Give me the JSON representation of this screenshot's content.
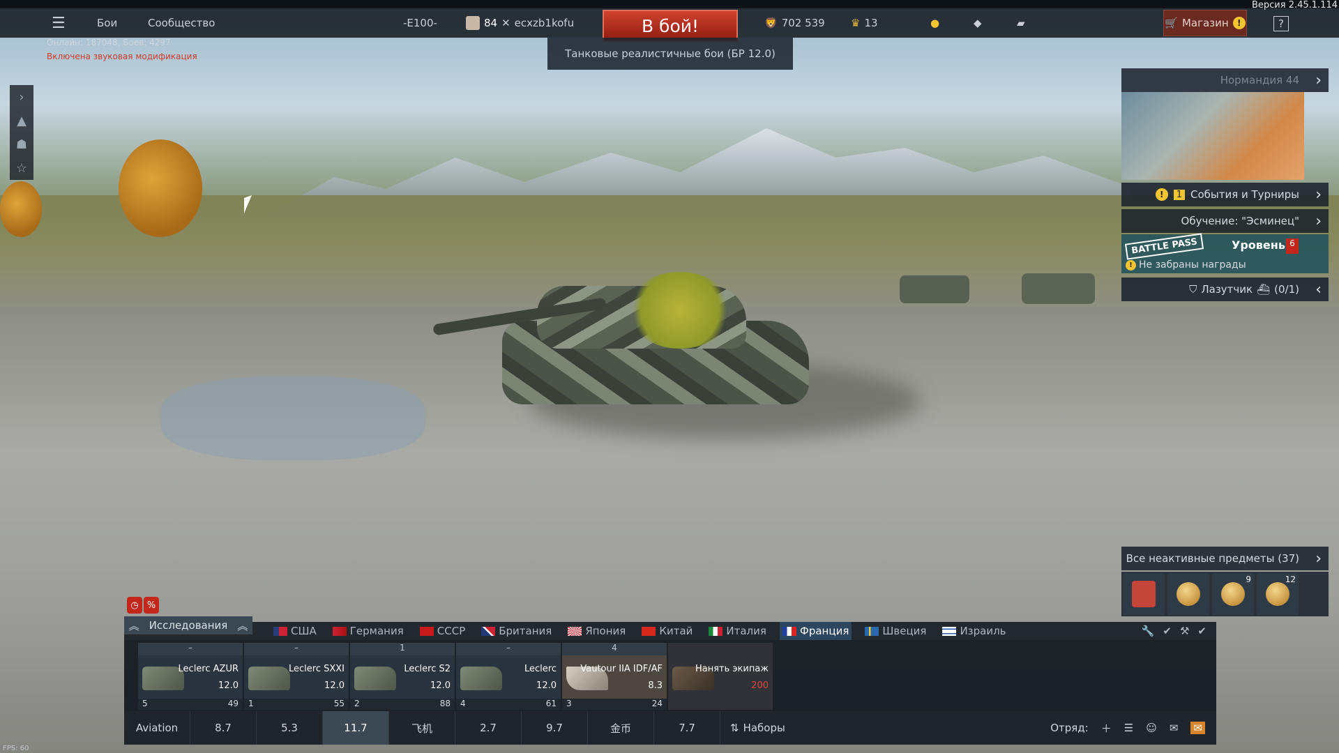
{
  "topbar": {
    "menu_items": [
      "Бои",
      "Сообщество"
    ],
    "vehicle_tag": "-E100-",
    "player_level": "84",
    "player_name": "ecxzb1kofu",
    "battle_button": "В бой!",
    "silver_lions": "702 539",
    "golden_eagles": "13",
    "shop_label": "Магазин",
    "help": "?",
    "version": "Версия 2.45.1.114"
  },
  "status": {
    "online": "Онлайн: 187048, Боев: 4297",
    "sound_mod": "Включена звуковая модификация"
  },
  "mode": {
    "label": "Танковые реалистичные бои (БР 12.0)"
  },
  "right_panel": {
    "normandy": "Нормандия 44",
    "events": "События и Турниры",
    "events_count": "1",
    "tutorial": "Обучение: \"Эсминец\"",
    "battle_pass_logo": "BATTLE PASS",
    "bp_level_label": "Уровень",
    "bp_level": "6",
    "bp_unclaimed": "Не забраны награды",
    "scout": "Лазутчик",
    "scout_count": "(0/1)",
    "inactive_items": "Все неактивные предметы (37)",
    "item_counts": [
      "",
      "",
      "9",
      "12"
    ]
  },
  "bottom": {
    "research_label": "Исследования",
    "nations": [
      {
        "name": "США",
        "flag": "usa-flag"
      },
      {
        "name": "Германия",
        "flag": "germany-flag"
      },
      {
        "name": "СССР",
        "flag": "ussr-flag"
      },
      {
        "name": "Британия",
        "flag": "britain-flag"
      },
      {
        "name": "Япония",
        "flag": "japan-flag"
      },
      {
        "name": "Китай",
        "flag": "china-flag"
      },
      {
        "name": "Италия",
        "flag": "italy-flag"
      },
      {
        "name": "Франция",
        "flag": "france-flag",
        "active": true
      },
      {
        "name": "Швеция",
        "flag": "sweden-flag"
      },
      {
        "name": "Израиль",
        "flag": "israel-flag"
      }
    ],
    "slots": [
      {
        "top": "–",
        "name": "Leclerc AZUR",
        "br": "12.0",
        "crew": "5",
        "cost": "49"
      },
      {
        "top": "–",
        "name": "Leclerc SXXI",
        "br": "12.0",
        "crew": "1",
        "cost": "55"
      },
      {
        "top": "1",
        "name": "Leclerc S2",
        "br": "12.0",
        "crew": "2",
        "cost": "88"
      },
      {
        "top": "–",
        "name": "Leclerc",
        "br": "12.0",
        "crew": "4",
        "cost": "61"
      },
      {
        "top": "4",
        "name": "Vautour IIA IDF/AF",
        "br": "8.3",
        "crew": "3",
        "cost": "24"
      },
      {
        "top": "",
        "name": "Нанять экипаж",
        "br": "200",
        "crew": "",
        "cost": ""
      }
    ],
    "br_bar": [
      "Aviation",
      "8.7",
      "5.3",
      "11.7",
      "飞机",
      "2.7",
      "9.7",
      "金币",
      "7.7"
    ],
    "br_active_index": 3,
    "sets_label": "Наборы",
    "squad_label": "Отряд:",
    "fps": "FPS: 60"
  },
  "colors": {
    "battle_red": "#c5321f",
    "active_nation": "#2c4660",
    "warning": "#f2c531"
  }
}
